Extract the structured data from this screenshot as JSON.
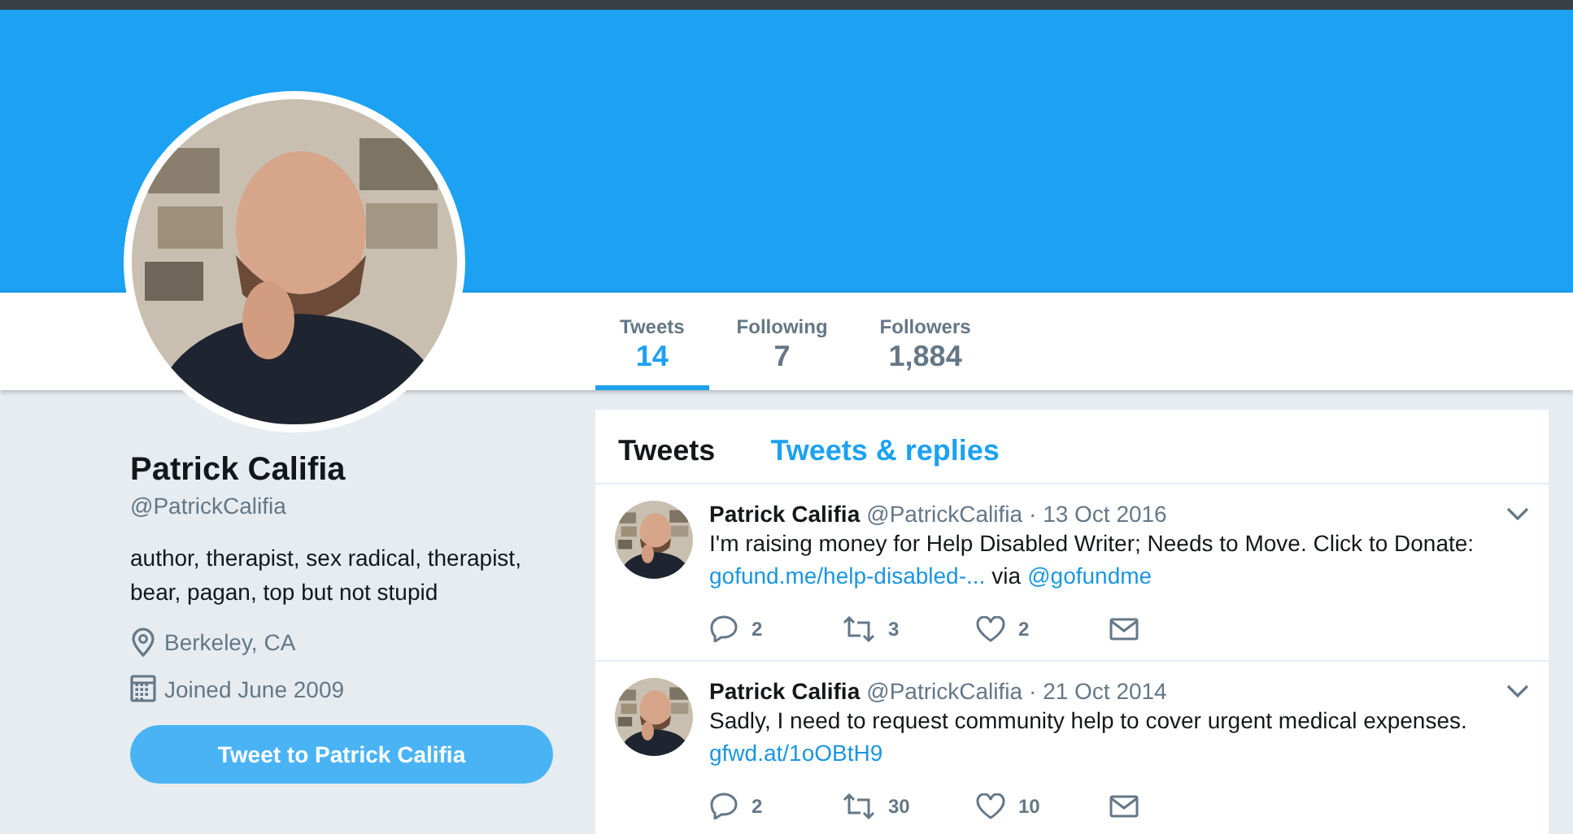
{
  "profile_nav": {
    "items": [
      {
        "label": "Tweets",
        "value": "14",
        "selected": true
      },
      {
        "label": "Following",
        "value": "7",
        "selected": false
      },
      {
        "label": "Followers",
        "value": "1,884",
        "selected": false
      }
    ]
  },
  "profile": {
    "name": "Patrick Califia",
    "handle": "@PatrickCalifia",
    "bio": "author, therapist, sex radical, therapist, bear, pagan, top but not stupid",
    "location": "Berkeley, CA",
    "joined": "Joined June 2009",
    "tweet_button": "Tweet to Patrick Califia"
  },
  "timeline": {
    "tabs": [
      {
        "label": "Tweets",
        "selected": true
      },
      {
        "label": "Tweets & replies",
        "selected": false
      }
    ],
    "tweets": [
      {
        "name": "Patrick Califia",
        "handle": "@PatrickCalifia",
        "date": "· 13 Oct 2016",
        "lines": [
          [
            {
              "kind": "text",
              "text": "I'm raising money for Help Disabled Writer; Needs to Move. Click to Donate:"
            }
          ],
          [
            {
              "kind": "link",
              "text": "gofund.me/help-disabled-..."
            },
            {
              "kind": "text",
              "text": "via"
            },
            {
              "kind": "link",
              "text": "@gofundme"
            }
          ]
        ],
        "replies": "2",
        "retweets": "3",
        "likes": "2"
      },
      {
        "name": "Patrick Califia",
        "handle": "@PatrickCalifia",
        "date": "· 21 Oct 2014",
        "lines": [
          [
            {
              "kind": "text",
              "text": "Sadly, I need to request community help to cover urgent medical expenses."
            }
          ],
          [
            {
              "kind": "link",
              "text": "gfwd.at/1oOBtH9"
            }
          ]
        ],
        "replies": "2",
        "retweets": "30",
        "likes": "10"
      }
    ]
  }
}
